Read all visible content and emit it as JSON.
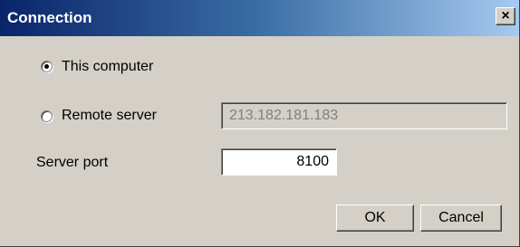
{
  "window": {
    "title": "Connection",
    "close_glyph": "×"
  },
  "options": {
    "this_computer": {
      "label": "This computer",
      "selected": true
    },
    "remote_server": {
      "label": "Remote server",
      "selected": false,
      "address": "213.182.181.183"
    }
  },
  "server_port": {
    "label": "Server port",
    "value": "8100"
  },
  "buttons": {
    "ok": "OK",
    "cancel": "Cancel"
  },
  "colors": {
    "title_start": "#0a246a",
    "title_end": "#a6caf0",
    "face": "#d4d0c8"
  }
}
